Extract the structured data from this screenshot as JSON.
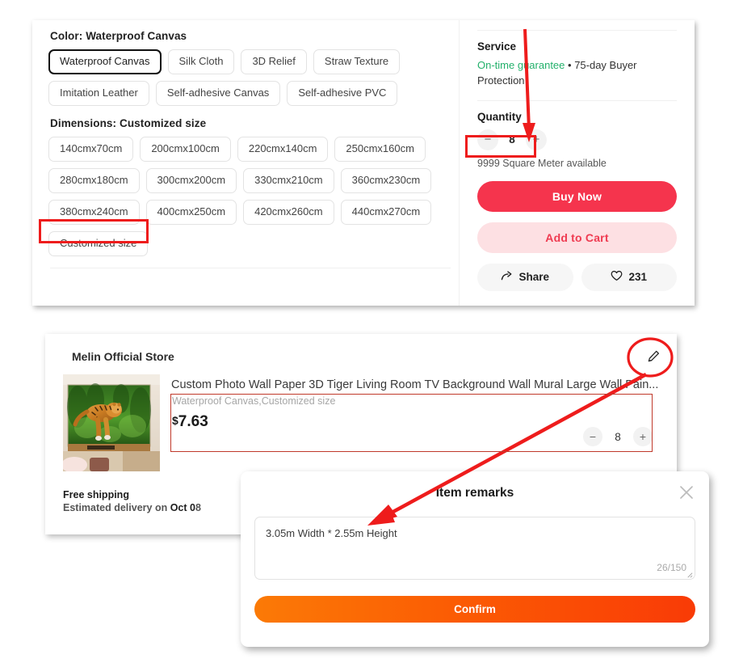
{
  "product_options": {
    "color": {
      "label": "Color: Waterproof Canvas",
      "options": [
        "Waterproof Canvas",
        "Silk Cloth",
        "3D Relief",
        "Straw Texture",
        "Imitation Leather",
        "Self-adhesive Canvas",
        "Self-adhesive PVC"
      ],
      "selected": "Waterproof Canvas"
    },
    "dimensions": {
      "label": "Dimensions: Customized size",
      "options": [
        "140cmx70cm",
        "200cmx100cm",
        "220cmx140cm",
        "250cmx160cm",
        "280cmx180cm",
        "300cmx200cm",
        "330cmx210cm",
        "360cmx230cm",
        "380cmx240cm",
        "400cmx250cm",
        "420cmx260cm",
        "440cmx270cm",
        "Customized size"
      ],
      "selected": "Customized size"
    }
  },
  "purchase_panel": {
    "service_heading": "Service",
    "service_green": "On-time guarantee",
    "service_sep": " • ",
    "service_rest": "75-day Buyer Protection",
    "quantity_heading": "Quantity",
    "quantity_value": "8",
    "minus_label": "−",
    "plus_label": "+",
    "availability": "9999 Square Meter available",
    "buy_now_label": "Buy Now",
    "add_to_cart_label": "Add to Cart",
    "share_label": "Share",
    "like_count": "231",
    "accent_red": "#f5344d",
    "accent_pink": "#fde0e3",
    "accent_green": "#23b06b"
  },
  "cart_card": {
    "store_name": "Melin Official Store",
    "item_title": "Custom Photo Wall Paper 3D Tiger Living Room TV Background Wall Mural Large Wall Pain...",
    "item_sku": "Waterproof Canvas,Customized size",
    "currency": "$",
    "price": "7.63",
    "quantity": "8",
    "minus_label": "−",
    "plus_label": "+",
    "shipping_title": "Free shipping",
    "shipping_estimate_prefix": "Estimated delivery on ",
    "shipping_estimate_bold": "Oct 0",
    "shipping_estimate_tail": "8",
    "edit_icon_name": "pencil-icon"
  },
  "modal": {
    "title": "Item remarks",
    "close_label": "✕",
    "remark_text": "3.05m Width * 2.55m Height",
    "char_count": "26/150",
    "confirm_label": "Confirm",
    "confirm_color": "#fb5a04"
  },
  "annotations": {
    "highlight_color": "#ee1c1c",
    "boxes": [
      "quantity-stepper",
      "customized-size-chip",
      "cart-item-details"
    ],
    "arrows": [
      "arrow-to-quantity",
      "arrow-to-item-remarks"
    ],
    "circle": "edit-pencil-circle"
  }
}
